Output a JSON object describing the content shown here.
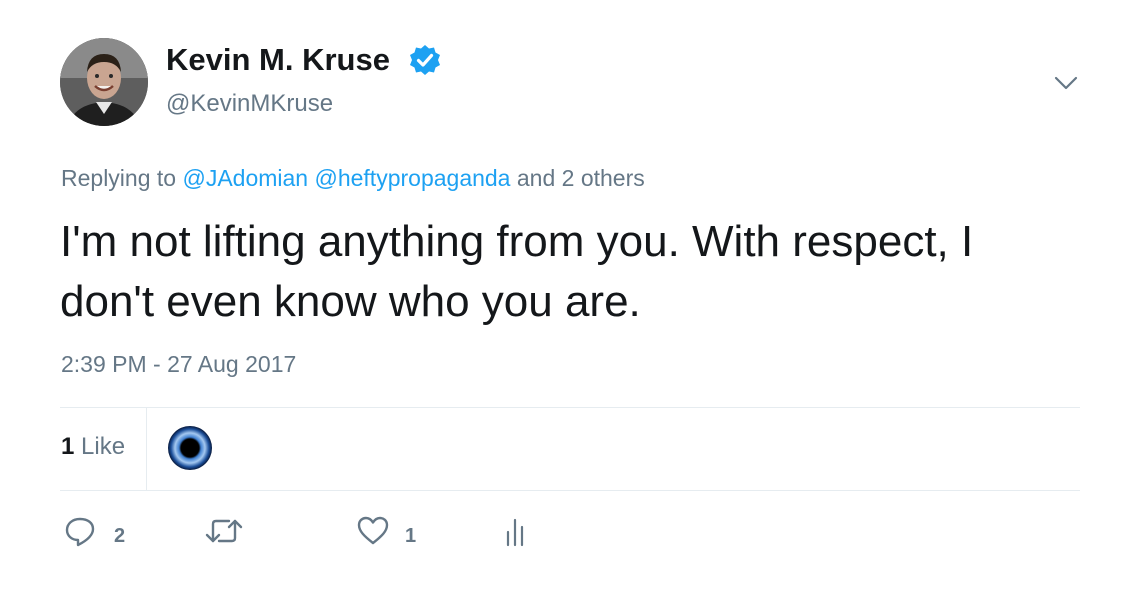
{
  "author": {
    "name": "Kevin M. Kruse",
    "handle": "@KevinMKruse"
  },
  "reply": {
    "prefix": "Replying to",
    "mention1": "@JAdomian",
    "mention2": "@heftypropaganda",
    "suffix": "and 2 others"
  },
  "tweet": {
    "text": "I'm not lifting anything from you. With respect, I don't even know who you are.",
    "timestamp": "2:39 PM - 27 Aug 2017"
  },
  "stats": {
    "likes_number": "1",
    "likes_label": "Like"
  },
  "actions": {
    "reply_count": "2",
    "like_count": "1"
  },
  "icons": {
    "verified": "verified-badge-icon",
    "caret": "chevron-down-icon",
    "reply": "reply-icon",
    "retweet": "retweet-icon",
    "like": "heart-icon",
    "analytics": "analytics-icon"
  },
  "colors": {
    "link": "#1da1f2",
    "secondary_text": "#657786",
    "primary_text": "#14171a",
    "divider": "#e6ecf0"
  }
}
